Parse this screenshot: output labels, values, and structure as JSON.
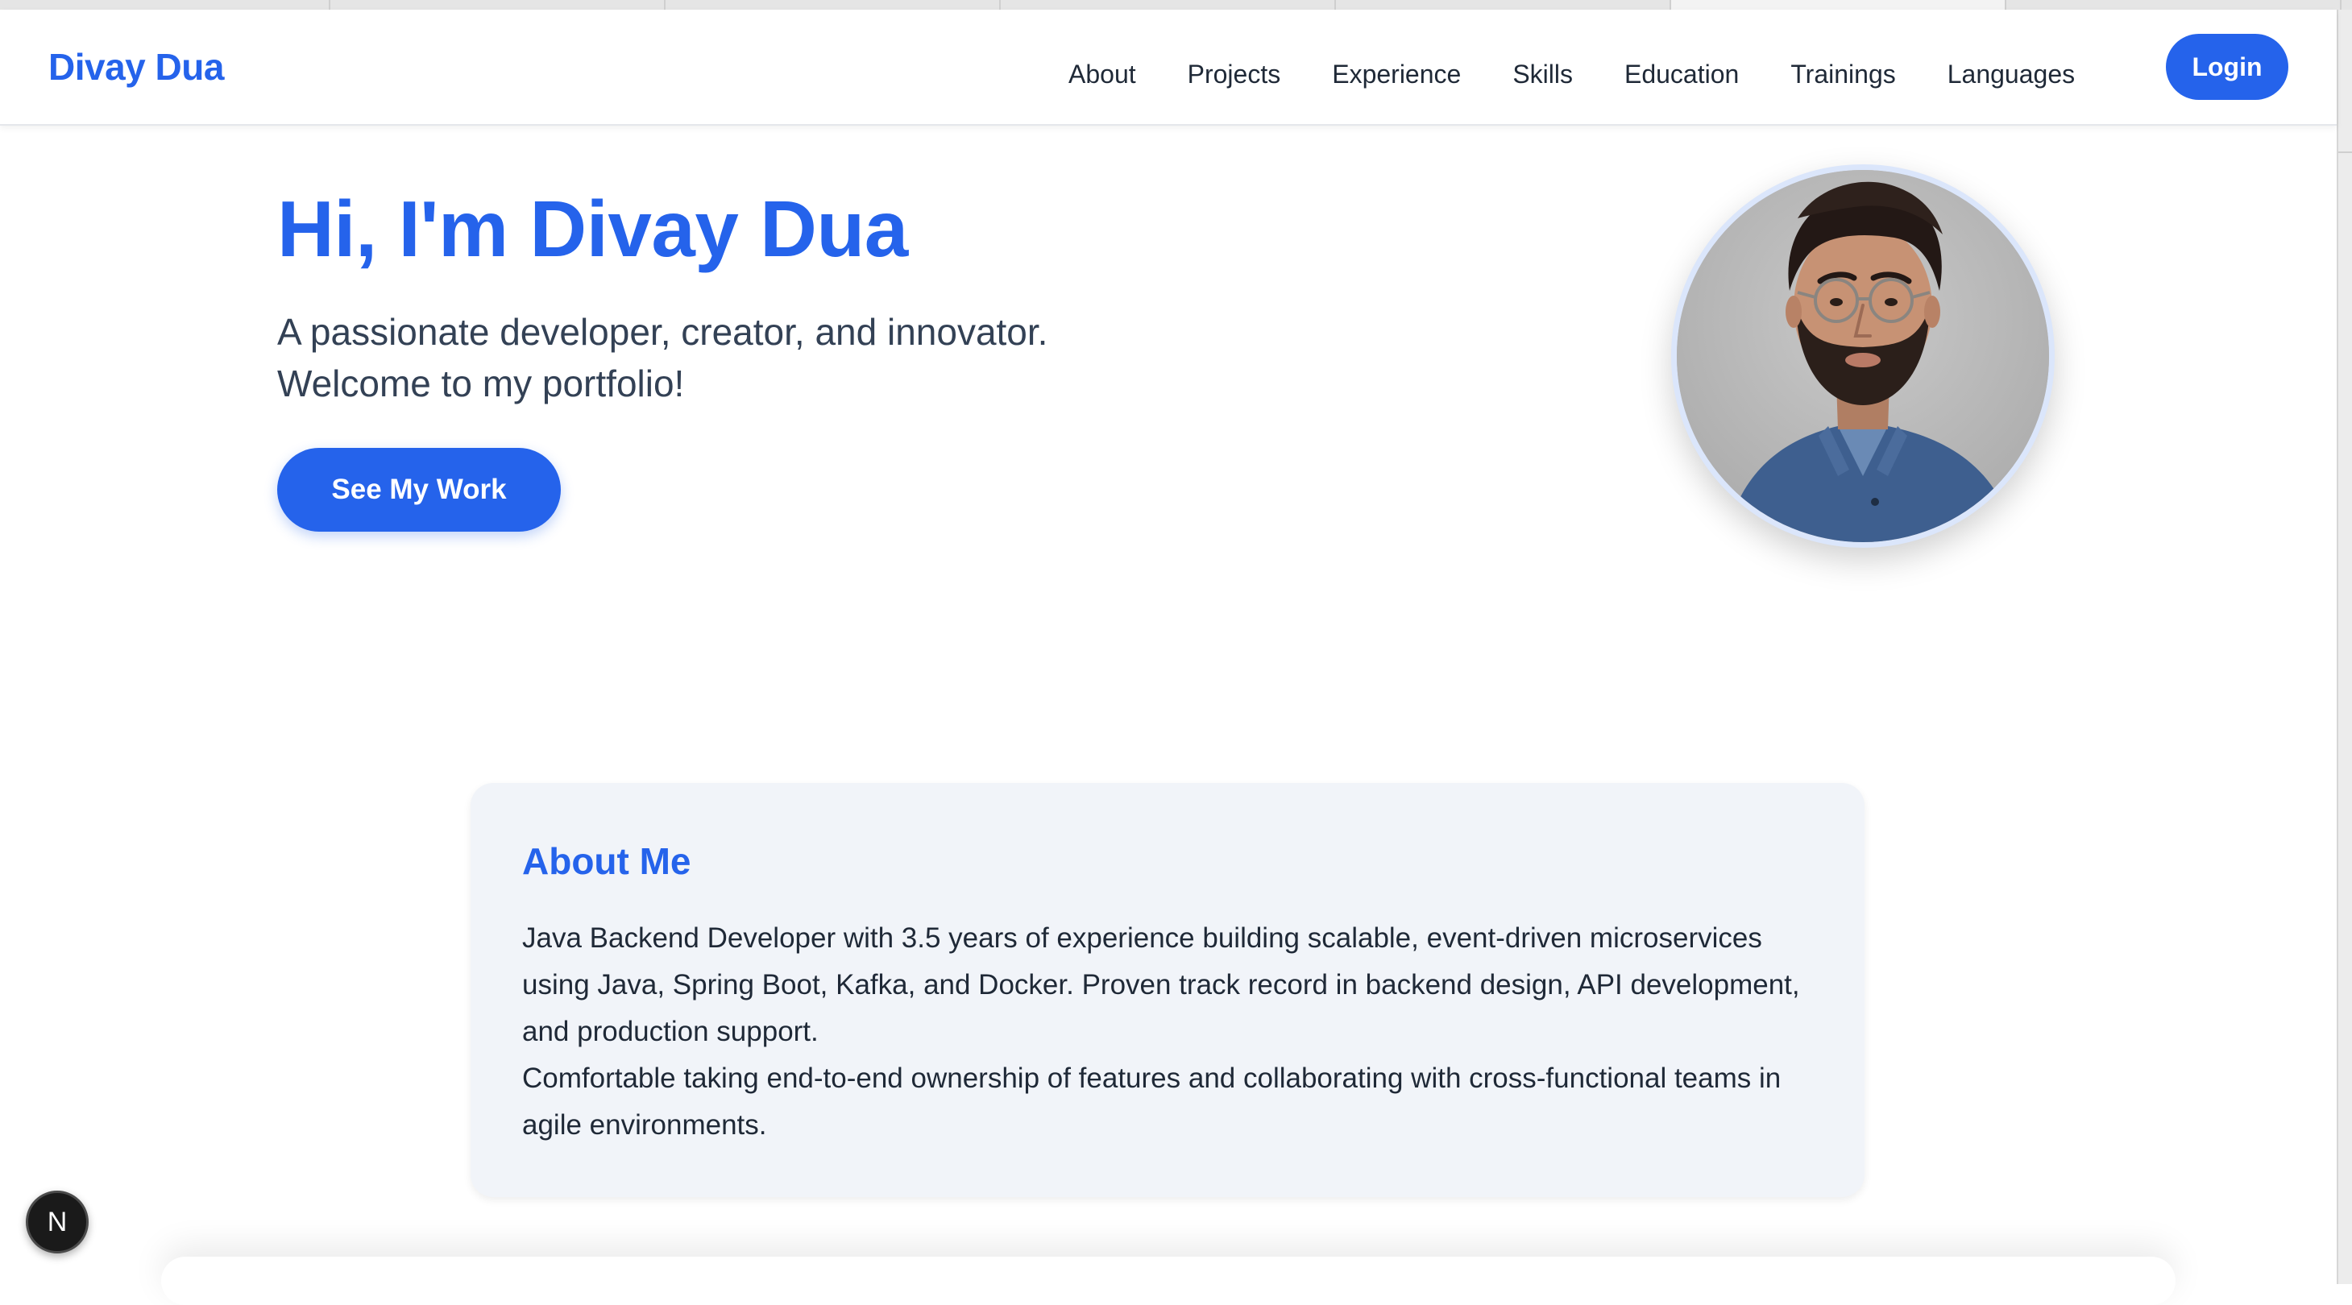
{
  "header": {
    "brand": "Divay Dua",
    "nav": [
      "About",
      "Projects",
      "Experience",
      "Skills",
      "Education",
      "Trainings",
      "Languages"
    ],
    "login_label": "Login"
  },
  "hero": {
    "title": "Hi, I'm Divay Dua",
    "subtitle_line1": "A passionate developer, creator, and innovator.",
    "subtitle_line2": "Welcome to my portfolio!",
    "cta_label": "See My Work"
  },
  "about": {
    "title": "About Me",
    "paragraph1": "Java Backend Developer with 3.5 years of experience building scalable, event-driven microservices using Java, Spring Boot, Kafka, and Docker. Proven track record in backend design, API development, and production support.",
    "paragraph2": "Comfortable taking end-to-end ownership of features and collaborating with cross-functional teams in agile environments."
  },
  "dev_indicator": {
    "letter": "N"
  },
  "colors": {
    "accent": "#2563eb",
    "card_bg": "#f1f4f9",
    "text": "#1f2937"
  }
}
